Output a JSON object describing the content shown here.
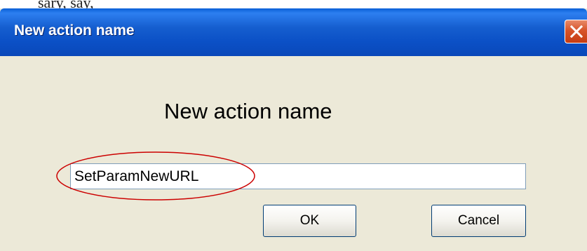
{
  "dialog": {
    "title": "New action name",
    "heading": "New action name",
    "input_value": "SetParamNewURL",
    "ok_label": "OK",
    "cancel_label": "Cancel"
  },
  "page_text": {
    "clipped_top_fragment": "sary, say,"
  },
  "colors": {
    "titlebar_blue": "#0b50c6",
    "dialog_background": "#ece9d8",
    "close_button_red": "#d7542a",
    "annotation_red": "#cc0000"
  },
  "icons": {
    "close": "close-x-icon"
  }
}
